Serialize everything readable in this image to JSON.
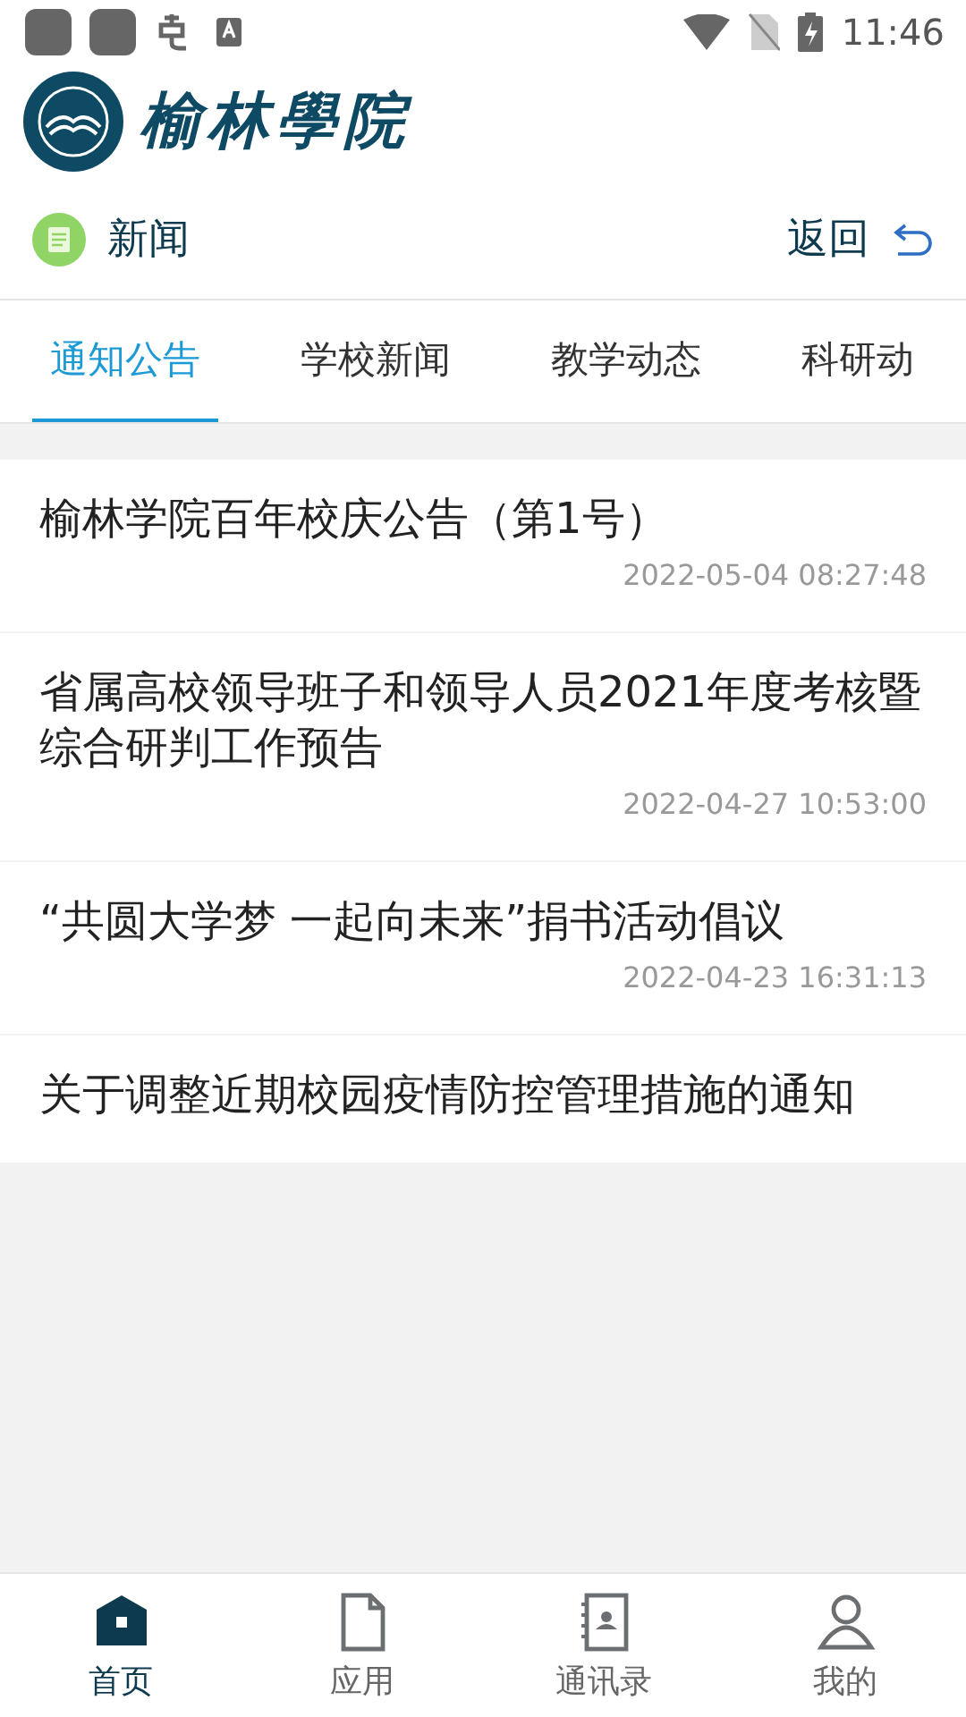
{
  "status_bar": {
    "time": "11:46"
  },
  "logo": {
    "text": "榆林學院"
  },
  "header": {
    "title": "新闻",
    "back": "返回"
  },
  "tabs": [
    {
      "label": "通知公告",
      "selected": true
    },
    {
      "label": "学校新闻",
      "selected": false
    },
    {
      "label": "教学动态",
      "selected": false
    },
    {
      "label": "科研动",
      "selected": false
    }
  ],
  "news": [
    {
      "title": "榆林学院百年校庆公告（第1号）",
      "date": "2022-05-04 08:27:48"
    },
    {
      "title": "省属高校领导班子和领导人员2021年度考核暨综合研判工作预告",
      "date": "2022-04-27 10:53:00"
    },
    {
      "title": "“共圆大学梦 一起向未来”捐书活动倡议",
      "date": "2022-04-23 16:31:13"
    },
    {
      "title": "关于调整近期校园疫情防控管理措施的通知"
    }
  ],
  "bottom_nav": [
    {
      "kind": "home",
      "label": "首页",
      "selected": true
    },
    {
      "kind": "apps",
      "label": "应用",
      "selected": false
    },
    {
      "kind": "contacts",
      "label": "通讯录",
      "selected": false
    },
    {
      "kind": "profile",
      "label": "我的",
      "selected": false
    }
  ]
}
